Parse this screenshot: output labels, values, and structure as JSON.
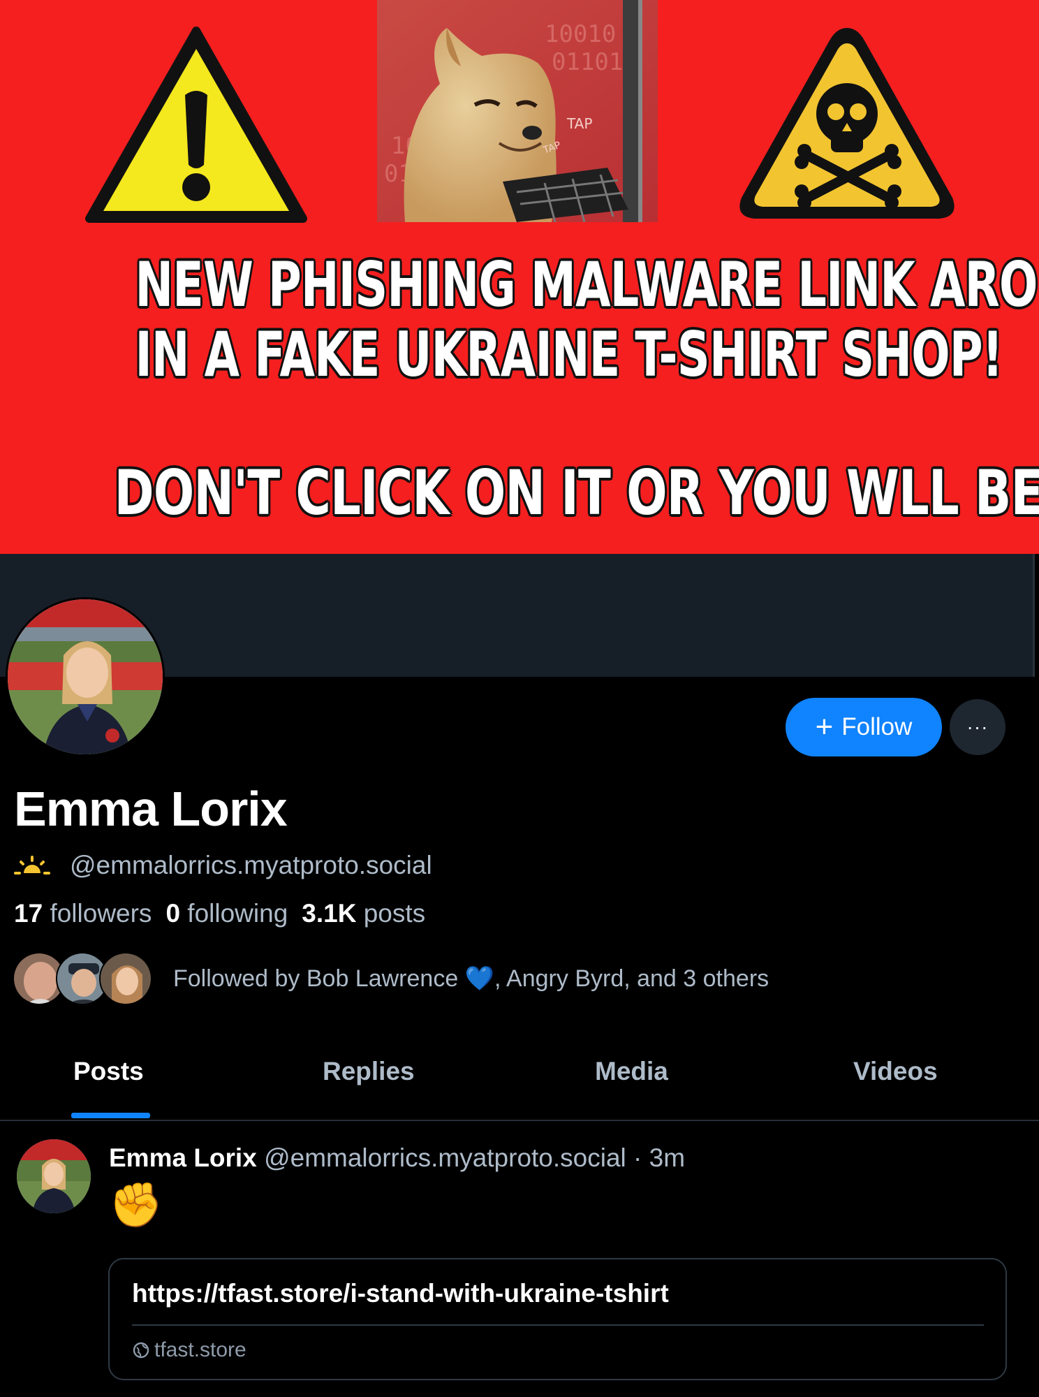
{
  "banner": {
    "headline_line1": "NEW PHISHING MALWARE LINK AROUND",
    "headline_line2": "IN A FAKE  UKRAINE T-SHIRT SHOP!",
    "headline_line3": "DON'T CLICK ON IT OR YOU WLL BE HACKED!",
    "meme_text_1": "TAP",
    "meme_text_2": "TAP",
    "colors": {
      "background": "#f51f1f",
      "sign_yellow": "#f4e81e"
    }
  },
  "profile": {
    "display_name": "Emma Lorix",
    "handle": "@emmalorrics.myatproto.social",
    "follow_label": "Follow",
    "more_label": "···",
    "stats": {
      "followers_count": "17",
      "followers_label": "followers",
      "following_count": "0",
      "following_label": "following",
      "posts_count": "3.1K",
      "posts_label": "posts"
    },
    "followed_by_prefix": "Followed by Bob Lawrence ",
    "followed_by_heart": "💙",
    "followed_by_suffix": ", Angry Byrd, and 3 others",
    "status_icon": "sunrise-icon"
  },
  "tabs": [
    {
      "label": "Posts",
      "active": true
    },
    {
      "label": "Replies",
      "active": false
    },
    {
      "label": "Media",
      "active": false
    },
    {
      "label": "Videos",
      "active": false
    }
  ],
  "post": {
    "author_name": "Emma Lorix",
    "author_handle": "@emmalorrics.myatproto.social",
    "separator": " · ",
    "time": "3m",
    "emoji": "✊",
    "link": {
      "url": "https://tfast.store/i-stand-with-ukraine-tshirt",
      "domain": "tfast.store"
    }
  },
  "colors": {
    "accent": "#1083fe",
    "muted_text": "#aebbc9",
    "cover": "#161e27"
  }
}
